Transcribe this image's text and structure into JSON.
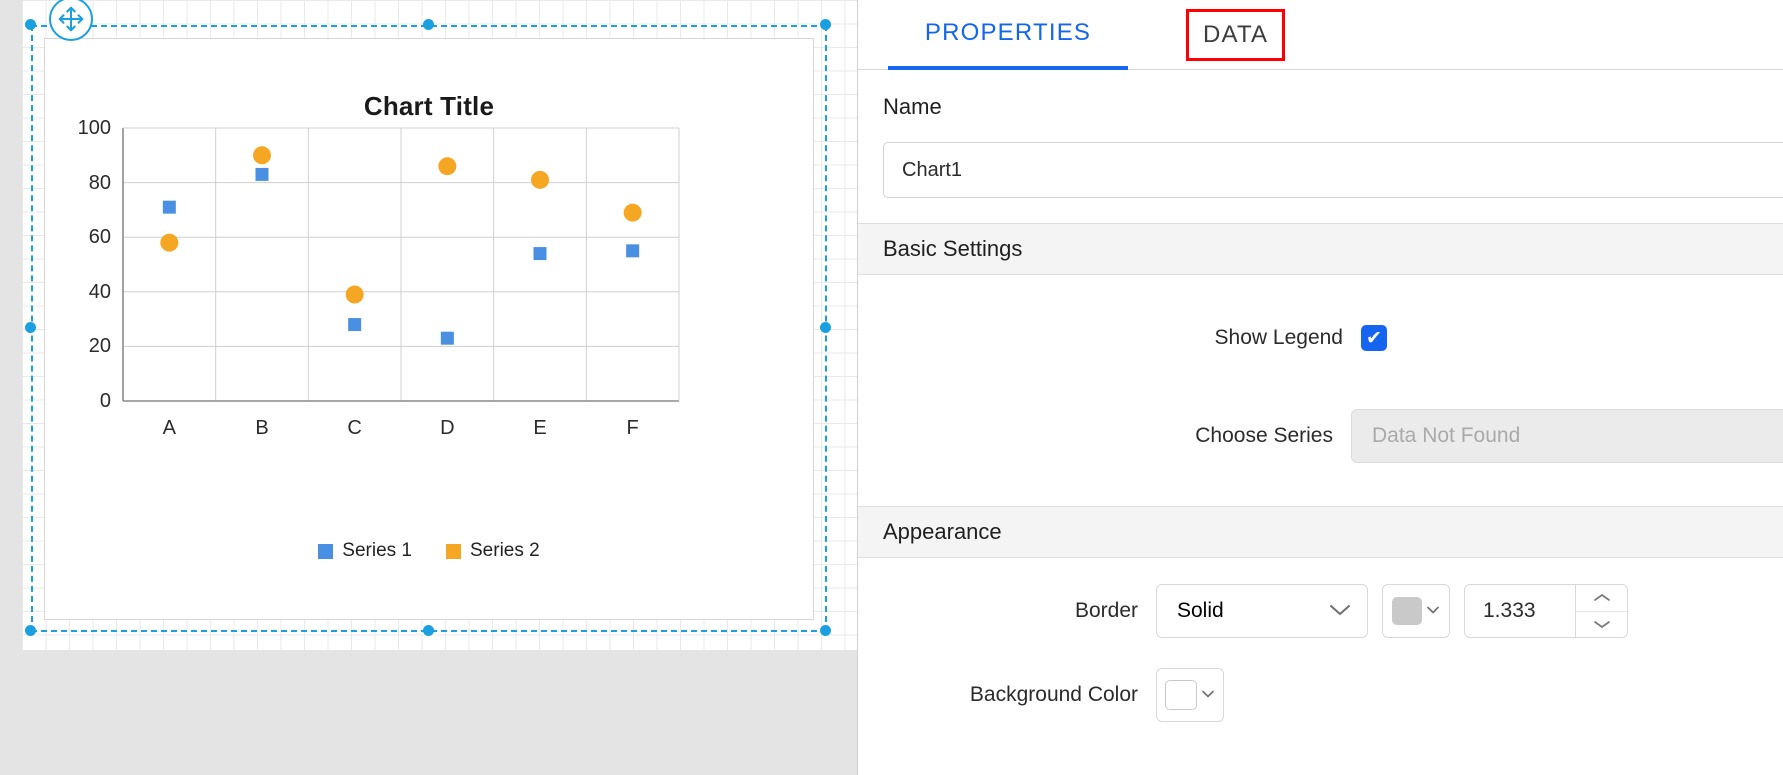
{
  "canvas": {
    "move_handle_icon": "move-cross-icon",
    "selection_handles": 8
  },
  "chart_data": {
    "type": "scatter",
    "title": "Chart Title",
    "xlabel": "",
    "ylabel": "",
    "categories": [
      "A",
      "B",
      "C",
      "D",
      "E",
      "F"
    ],
    "yticks": [
      0,
      20,
      40,
      60,
      80,
      100
    ],
    "ylim": [
      0,
      100
    ],
    "grid": true,
    "legend_position": "bottom",
    "series": [
      {
        "name": "Series 1",
        "color": "#4a90e2",
        "marker": "square",
        "values": [
          71,
          83,
          28,
          23,
          54,
          55
        ]
      },
      {
        "name": "Series 2",
        "color": "#f5a623",
        "marker": "circle",
        "values": [
          58,
          90,
          39,
          86,
          81,
          69
        ]
      }
    ]
  },
  "panel": {
    "tabs": [
      {
        "label": "PROPERTIES",
        "active": true
      },
      {
        "label": "DATA",
        "active": false,
        "highlight_color": "#ff0000"
      }
    ],
    "name": {
      "label": "Name",
      "value": "Chart1"
    },
    "basic_settings": {
      "title": "Basic Settings",
      "collapse_icon": "minus-icon",
      "show_legend": {
        "label": "Show Legend",
        "checked": true,
        "checkmark": "✔",
        "accent": "#1565f0",
        "binding_checkbox": false
      },
      "choose_series": {
        "label": "Choose Series",
        "value": "Data Not Found",
        "disabled": true,
        "chevron_icon": "chevron-down-icon",
        "edit_icon": "pencil-icon"
      }
    },
    "appearance": {
      "title": "Appearance",
      "collapse_icon": "minus-icon",
      "border": {
        "label": "Border",
        "style": "Solid",
        "color_swatch": "#c9c9c9",
        "width": "1.333",
        "chevron_icon": "chevron-down-icon",
        "stepper_up_icon": "chevron-up-icon",
        "stepper_down_icon": "chevron-down-icon",
        "binding_checkbox": false
      },
      "background_color": {
        "label": "Background Color",
        "color_swatch": "#ffffff",
        "chevron_icon": "chevron-down-icon",
        "binding_checkbox": false
      }
    }
  }
}
